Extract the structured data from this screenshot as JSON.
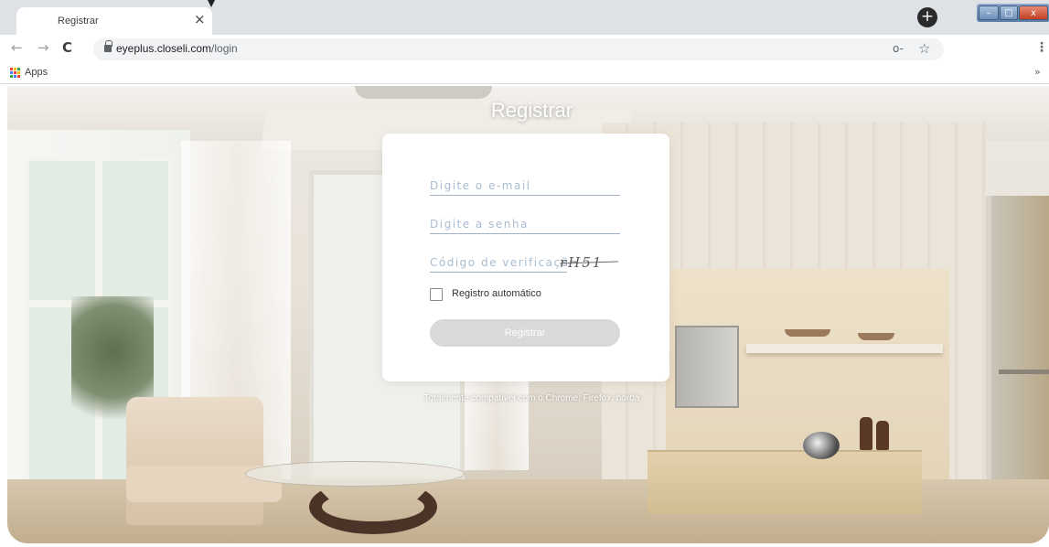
{
  "browser": {
    "tab": {
      "title": "Registrar",
      "close_glyph": "×"
    },
    "new_tab_glyph": "+",
    "window_controls": {
      "minimize": "–",
      "maximize": "□",
      "close": "x"
    },
    "nav": {
      "back": "←",
      "forward": "→",
      "reload": "C"
    },
    "address": {
      "host": "eyeplus.closeli.com",
      "path": "/login"
    },
    "key_icon_glyph": "o-",
    "star_icon_glyph": "☆",
    "menu_glyph": "⋮",
    "bookmarks": {
      "apps_label": "Apps",
      "more_glyph": "»"
    },
    "apps_colors": [
      "#ea4335",
      "#fbbc04",
      "#34a853",
      "#4285f4",
      "#ea4335",
      "#fbbc04",
      "#34a853",
      "#4285f4",
      "#ea4335"
    ]
  },
  "page": {
    "heading": "Registrar",
    "form": {
      "email_placeholder": "Digite o e-mail",
      "password_placeholder": "Digite a senha",
      "code_placeholder": "Código de verificação",
      "captcha_text": "rH51",
      "auto_login_label": "Registro automático",
      "submit_label": "Registrar"
    },
    "footnote": "Totalmente compatível com o Chrome, Firefox, borda"
  }
}
